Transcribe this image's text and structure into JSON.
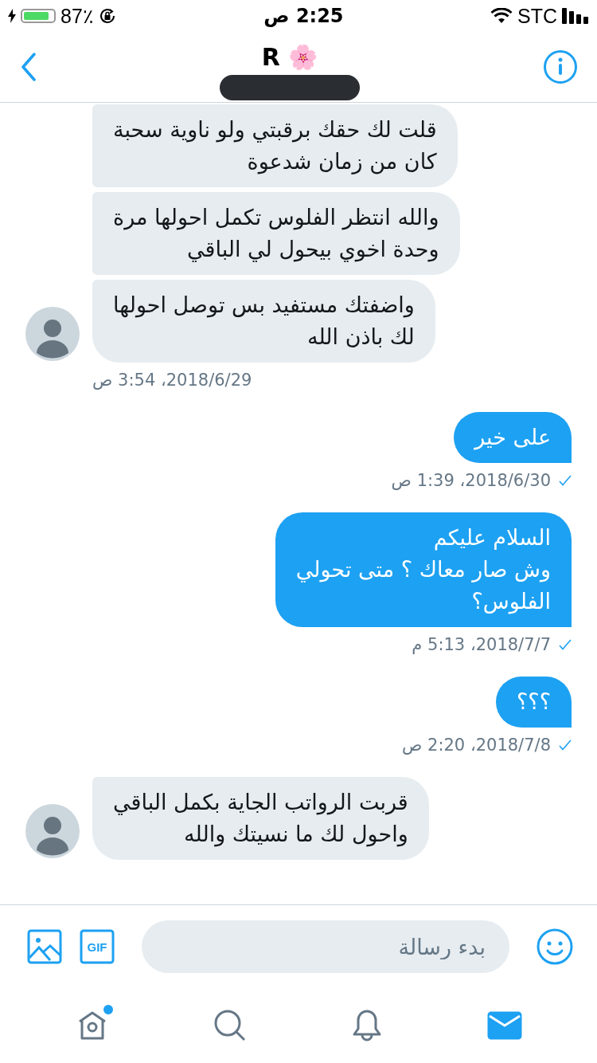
{
  "status_bar": {
    "battery_percent": "87٪",
    "battery": {
      "level": 0.87
    },
    "time": "2:25 ص",
    "carrier": "STC"
  },
  "header": {
    "title": "R 🌸"
  },
  "messages": [
    {
      "kind": "received",
      "bubbles": [
        "قلت لك حقك برقبتي ولو ناوية سحبة\nكان من زمان شدعوة",
        "والله انتظر الفلوس تكمل احولها مرة\nوحدة اخوي بيحول لي الباقي",
        "واضفتك مستفيد بس توصل احولها\nلك باذن الله"
      ],
      "time": "2018/6/29، 3:54 ص"
    },
    {
      "kind": "sent",
      "bubbles": [
        "على خير"
      ],
      "time": "2018/6/30، 1:39 ص",
      "read": true
    },
    {
      "kind": "sent",
      "bubbles": [
        "السلام عليكم\nوش صار معاك ؟ متى تحولي\nالفلوس؟"
      ],
      "time": "2018/7/7، 5:13 م",
      "read": true
    },
    {
      "kind": "sent",
      "bubbles": [
        "؟؟؟"
      ],
      "time": "2018/7/8، 2:20 ص",
      "read": true
    },
    {
      "kind": "received",
      "bubbles": [
        "قربت الرواتب الجاية بكمل الباقي\nواحول لك ما نسيتك والله"
      ]
    }
  ],
  "composer": {
    "gif_label": "GIF",
    "placeholder": "بدء رسالة"
  },
  "tab_bar": [
    {
      "kind": "home",
      "selected": false,
      "badge": true
    },
    {
      "kind": "search",
      "selected": false,
      "badge": false
    },
    {
      "kind": "notifications",
      "selected": false,
      "badge": false
    },
    {
      "kind": "messages",
      "selected": true,
      "badge": false
    }
  ]
}
